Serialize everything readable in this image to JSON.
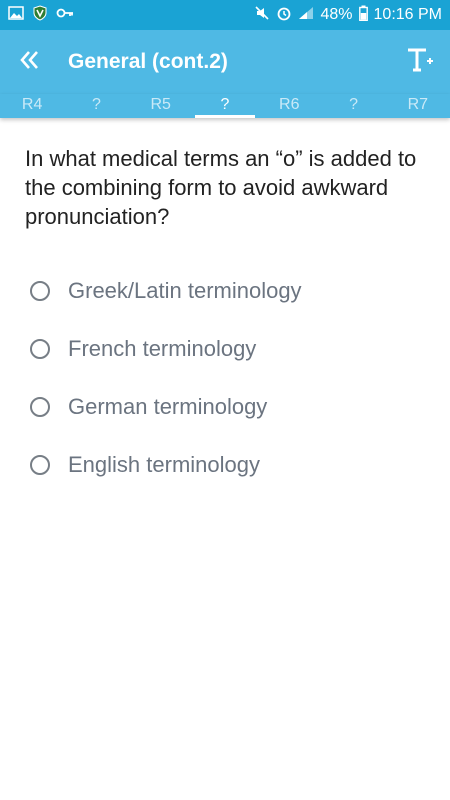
{
  "status": {
    "battery": "48%",
    "time": "10:16 PM"
  },
  "header": {
    "title": "General (cont.2)"
  },
  "tabs": [
    "R4",
    "?",
    "R5",
    "?",
    "R6",
    "?",
    "R7"
  ],
  "question": "In what medical terms an “o” is added to the combining form to avoid awkward pronunciation?",
  "options": [
    "Greek/Latin terminology",
    "French terminology",
    "German terminology",
    "English terminology"
  ],
  "colors": {
    "statusbar": "#1aa3d4",
    "appbar": "#4fb9e4",
    "option_text": "#6b7480"
  }
}
